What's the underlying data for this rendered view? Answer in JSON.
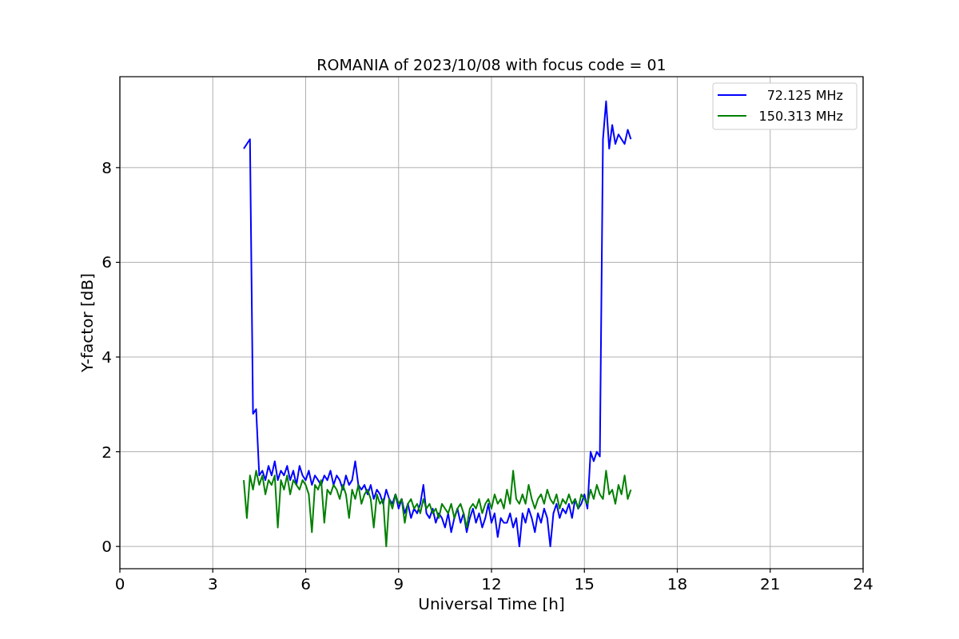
{
  "chart_data": {
    "type": "line",
    "title": "ROMANIA of 2023/10/08 with focus code = 01",
    "xlabel": "Universal Time [h]",
    "ylabel": "Y-factor [dB]",
    "xlim": [
      0,
      24
    ],
    "ylim": [
      -0.47,
      9.92
    ],
    "xticks": [
      0,
      3,
      6,
      9,
      12,
      15,
      18,
      21,
      24
    ],
    "yticks": [
      0,
      2,
      4,
      6,
      8
    ],
    "grid": true,
    "legend": true,
    "x": [
      4.0,
      4.1,
      4.2,
      4.3,
      4.4,
      4.5,
      4.6,
      4.7,
      4.8,
      4.9,
      5.0,
      5.1,
      5.2,
      5.3,
      5.4,
      5.5,
      5.6,
      5.7,
      5.8,
      5.9,
      6.0,
      6.1,
      6.2,
      6.3,
      6.4,
      6.5,
      6.6,
      6.7,
      6.8,
      6.9,
      7.0,
      7.1,
      7.2,
      7.3,
      7.4,
      7.5,
      7.6,
      7.7,
      7.8,
      7.9,
      8.0,
      8.1,
      8.2,
      8.3,
      8.4,
      8.5,
      8.6,
      8.7,
      8.8,
      8.9,
      9.0,
      9.1,
      9.2,
      9.3,
      9.4,
      9.5,
      9.6,
      9.7,
      9.8,
      9.9,
      10.0,
      10.1,
      10.2,
      10.3,
      10.4,
      10.5,
      10.6,
      10.7,
      10.8,
      10.9,
      11.0,
      11.1,
      11.2,
      11.3,
      11.4,
      11.5,
      11.6,
      11.7,
      11.8,
      11.9,
      12.0,
      12.1,
      12.2,
      12.3,
      12.4,
      12.5,
      12.6,
      12.7,
      12.8,
      12.9,
      13.0,
      13.1,
      13.2,
      13.3,
      13.4,
      13.5,
      13.6,
      13.7,
      13.8,
      13.9,
      14.0,
      14.1,
      14.2,
      14.3,
      14.4,
      14.5,
      14.6,
      14.7,
      14.8,
      14.9,
      15.0,
      15.1,
      15.2,
      15.3,
      15.4,
      15.5,
      15.6,
      15.7,
      15.8,
      15.9,
      16.0,
      16.1,
      16.2,
      16.3,
      16.4,
      16.5
    ],
    "series": [
      {
        "name": "72.125 MHz",
        "color": "#0000ff",
        "values": [
          8.4,
          8.5,
          8.6,
          2.8,
          2.9,
          1.5,
          1.6,
          1.4,
          1.7,
          1.5,
          1.8,
          1.4,
          1.6,
          1.5,
          1.7,
          1.4,
          1.6,
          1.3,
          1.7,
          1.5,
          1.4,
          1.6,
          1.3,
          1.5,
          1.4,
          1.3,
          1.5,
          1.4,
          1.6,
          1.3,
          1.5,
          1.4,
          1.2,
          1.5,
          1.3,
          1.4,
          1.8,
          1.3,
          1.2,
          1.3,
          1.1,
          1.3,
          1.0,
          1.2,
          1.1,
          0.9,
          1.2,
          1.0,
          0.9,
          1.1,
          0.8,
          1.0,
          0.7,
          0.9,
          0.6,
          0.8,
          0.7,
          0.9,
          1.3,
          0.7,
          0.6,
          0.8,
          0.5,
          0.7,
          0.6,
          0.4,
          0.7,
          0.3,
          0.6,
          0.8,
          0.5,
          0.7,
          0.3,
          0.6,
          0.8,
          0.5,
          0.7,
          0.4,
          0.6,
          0.9,
          0.5,
          0.7,
          0.2,
          0.6,
          0.5,
          0.5,
          0.7,
          0.4,
          0.6,
          0.0,
          0.7,
          0.5,
          0.8,
          0.6,
          0.3,
          0.7,
          0.5,
          0.8,
          0.6,
          0.0,
          0.7,
          0.9,
          0.6,
          0.8,
          0.7,
          0.9,
          0.6,
          1.0,
          0.8,
          0.9,
          1.1,
          0.8,
          2.0,
          1.8,
          2.0,
          1.9,
          8.6,
          9.4,
          8.4,
          8.9,
          8.5,
          8.7,
          8.6,
          8.5,
          8.8,
          8.6
        ]
      },
      {
        "name": "150.313 MHz",
        "color": "#008000",
        "values": [
          1.4,
          0.6,
          1.5,
          1.2,
          1.6,
          1.3,
          1.5,
          1.1,
          1.4,
          1.3,
          1.5,
          0.4,
          1.4,
          1.2,
          1.5,
          1.1,
          1.4,
          1.3,
          1.2,
          1.4,
          1.3,
          1.1,
          0.3,
          1.3,
          1.2,
          1.4,
          0.5,
          1.2,
          1.1,
          1.3,
          1.2,
          1.0,
          1.3,
          1.1,
          0.6,
          1.2,
          1.0,
          1.3,
          0.9,
          1.1,
          1.2,
          1.0,
          0.4,
          1.1,
          0.9,
          1.0,
          0.0,
          1.0,
          0.8,
          1.1,
          0.9,
          1.0,
          0.5,
          0.9,
          1.0,
          0.8,
          0.9,
          0.7,
          1.0,
          0.8,
          0.9,
          0.7,
          0.8,
          0.6,
          0.9,
          0.8,
          0.7,
          0.9,
          0.6,
          0.8,
          0.9,
          0.7,
          0.4,
          0.8,
          0.9,
          0.8,
          1.0,
          0.7,
          0.9,
          1.0,
          0.8,
          1.1,
          0.9,
          1.0,
          0.8,
          1.2,
          0.9,
          1.6,
          1.0,
          0.9,
          1.1,
          0.9,
          1.3,
          1.0,
          0.8,
          1.0,
          1.1,
          0.9,
          1.2,
          1.0,
          0.9,
          1.1,
          0.8,
          1.0,
          0.9,
          1.1,
          0.9,
          1.0,
          0.8,
          1.1,
          1.0,
          0.9,
          1.2,
          1.0,
          1.3,
          1.1,
          1.0,
          1.6,
          1.1,
          1.2,
          0.9,
          1.3,
          1.1,
          1.5,
          1.0,
          1.2
        ]
      }
    ]
  }
}
